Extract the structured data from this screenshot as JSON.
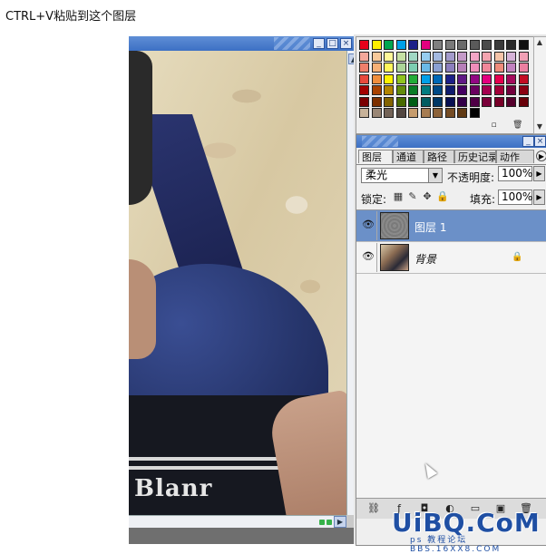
{
  "caption": "CTRL+V粘贴到这个图层",
  "doc_window": {
    "shirt_text": "Blanr",
    "scroll_arrow": "▶",
    "scroll_up": "▲"
  },
  "swatches": {
    "colors": [
      [
        "#e8001a",
        "#ffef00",
        "#00a650",
        "#00a0e9",
        "#1d2088",
        "#e4007f",
        "#808080",
        "#7a7a7a",
        "#6a6a6a",
        "#5a5a5a",
        "#4a4a4a",
        "#3a3a3a",
        "#2a2a2a",
        "#111111"
      ],
      [
        "#f5a89a",
        "#f8c99a",
        "#fff799",
        "#c6e0a4",
        "#a0d7c4",
        "#96cdef",
        "#a4b9e0",
        "#a39bcb",
        "#c49ac8",
        "#f3a5c6",
        "#f4a4b0",
        "#f5c3a8",
        "#d6b3d8",
        "#f1a0b5"
      ],
      [
        "#ef7f6b",
        "#f6b076",
        "#fff45c",
        "#acd598",
        "#7ccdb2",
        "#6ab9e7",
        "#8aa0d2",
        "#8c7fbd",
        "#b67fb8",
        "#f08dba",
        "#f0879a",
        "#ee8c7c",
        "#c282c0",
        "#ec7fa0"
      ],
      [
        "#e8493c",
        "#f08e3c",
        "#fff100",
        "#8fc31f",
        "#22ac38",
        "#00a0e9",
        "#0068b7",
        "#1d2088",
        "#601986",
        "#920783",
        "#e4007f",
        "#e5004f",
        "#a40b5d",
        "#c30d23"
      ],
      [
        "#a40000",
        "#a84200",
        "#b28500",
        "#638c0b",
        "#097c25",
        "#007b80",
        "#004986",
        "#0f1c6e",
        "#440062",
        "#6a005f",
        "#a4004f",
        "#a20038",
        "#73003d",
        "#8b0012"
      ],
      [
        "#7a0000",
        "#7d3000",
        "#836300",
        "#486a00",
        "#005e15",
        "#005c61",
        "#003766",
        "#070f52",
        "#330048",
        "#4f0046",
        "#7a003a",
        "#780028",
        "#55002c",
        "#680009"
      ],
      [
        "#c7b299",
        "#998675",
        "#736357",
        "#534741",
        "#c69c6d",
        "#a67c52",
        "#8c6239",
        "#754c24",
        "#603913",
        "#000000"
      ]
    ],
    "new_icon": "▫",
    "trash_icon": "🗑",
    "scroll_up": "▲",
    "scroll_down": "▼"
  },
  "layers_panel": {
    "tabs": [
      {
        "label": "图层",
        "active": true
      },
      {
        "label": "通道",
        "active": false
      },
      {
        "label": "路径",
        "active": false
      },
      {
        "label": "历史记录",
        "active": false
      },
      {
        "label": "动作",
        "active": false
      }
    ],
    "tab_menu": "▶",
    "blend_mode": "柔光",
    "dropdown_arrow": "▼",
    "opacity_label": "不透明度:",
    "opacity_value": "100%",
    "lock_label": "锁定:",
    "fill_label": "填充:",
    "fill_value": "100%",
    "stepper_arrow": "▶",
    "lock_icons": [
      "▦",
      "✎",
      "✥",
      "🔒"
    ],
    "layers": [
      {
        "name": "图层 1",
        "selected": true,
        "visible": true
      },
      {
        "name": "背景",
        "selected": false,
        "visible": true,
        "locked": true
      }
    ],
    "eye_glyph": "👁",
    "lock_badge": "🔒",
    "footer_icons": [
      "⛓",
      "ƒ",
      "◘",
      "◐",
      "▭",
      "▣",
      "🗑"
    ]
  },
  "watermark": {
    "main": "UiBQ.CoM",
    "sub": "ps 教程论坛 BBS.16XX8.COM"
  }
}
